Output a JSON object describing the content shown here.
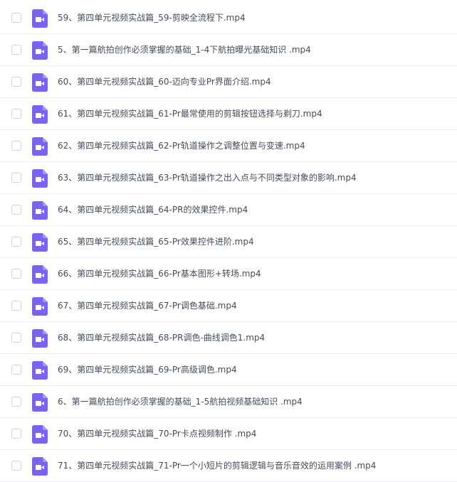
{
  "accent_color": "#7b63f0",
  "icon_name": "video-file-icon",
  "files": [
    {
      "name": "59、第四单元视频实战篇_59-剪映全流程下.mp4"
    },
    {
      "name": "5、第一篇航拍创作必须掌握的基础_1-4下航拍曝光基础知识 .mp4"
    },
    {
      "name": "60、第四单元视频实战篇_60-迈向专业Pr界面介绍.mp4"
    },
    {
      "name": "61、第四单元视频实战篇_61-Pr最常使用的剪辑按钮选择与剃刀.mp4"
    },
    {
      "name": "62、第四单元视频实战篇_62-Pr轨道操作之调整位置与变速.mp4"
    },
    {
      "name": "63、第四单元视频实战篇_63-Pr轨道操作之出入点与不同类型对象的影响.mp4"
    },
    {
      "name": "64、第四单元视频实战篇_64-PR的效果控件.mp4"
    },
    {
      "name": "65、第四单元视频实战篇_65-Pr效果控件进阶.mp4"
    },
    {
      "name": "66、第四单元视频实战篇_66-Pr基本图形+转场.mp4"
    },
    {
      "name": "67、第四单元视频实战篇_67-Pr调色基础.mp4"
    },
    {
      "name": "68、第四单元视频实战篇_68-PR调色-曲线调色1.mp4"
    },
    {
      "name": "69、第四单元视频实战篇_69-Pr高级调色.mp4"
    },
    {
      "name": "6、第一篇航拍创作必须掌握的基础_1-5航拍视频基础知识 .mp4"
    },
    {
      "name": "70、第四单元视频实战篇_70-Pr卡点视频制作 .mp4"
    },
    {
      "name": "71、第四单元视频实战篇_71-Pr一个小短片的剪辑逻辑与音乐音效的运用案例 .mp4"
    }
  ]
}
